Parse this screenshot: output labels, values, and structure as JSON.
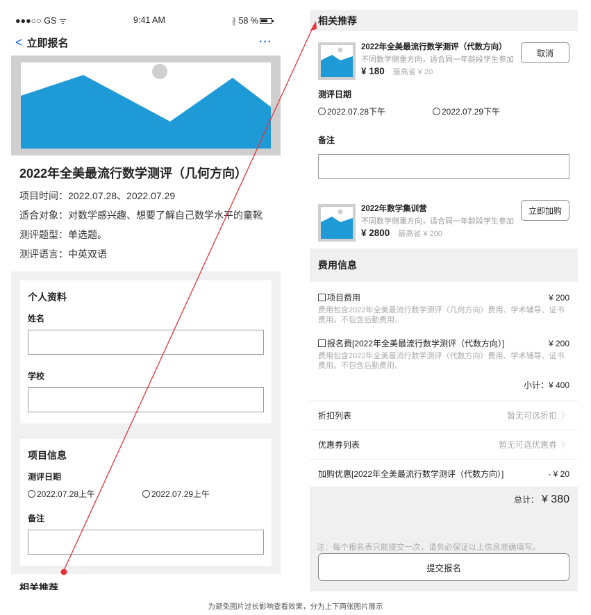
{
  "status_bar": {
    "carrier": "●●●○○ GS",
    "wifi_icon": "wifi-icon",
    "time": "9:41 AM",
    "battery": "58 %",
    "bluetooth_icon": "bluetooth-icon"
  },
  "nav": {
    "back_label": "立即报名",
    "more": "···"
  },
  "event": {
    "title": "2022年全美最流行数学测评（几何方向）",
    "time": "项目时间：2022.07.28、2022.07.29",
    "audience": "适合对象：对数学感兴趣、想要了解自己数学水平的童靴",
    "question_type": "测评题型：单选题。",
    "language": "测评语言：中英双语"
  },
  "personal": {
    "heading": "个人资料",
    "name_label": "姓名",
    "school_label": "学校"
  },
  "project": {
    "heading": "项目信息",
    "date_label": "测评日期",
    "date_options": [
      "2022.07.28上午",
      "2022.07.29上午"
    ],
    "remark_label": "备注"
  },
  "left_footer": {
    "related": "相关推荐"
  },
  "related": {
    "heading": "相关推荐",
    "item1": {
      "name": "2022年全美最流行数学测评（代数方向）",
      "desc": "不同数学侧重方向，适合同一年龄段学生参加",
      "price": "¥ 180",
      "save": "最高省 ¥ 20",
      "button": "取消"
    },
    "date_label": "测评日期",
    "date_options": [
      "2022.07.28下午",
      "2022.07.29下午"
    ],
    "remark_label": "备注",
    "item2": {
      "name": "2022年数学集训营",
      "desc": "不同数学侧重方向，适合同一年龄段学生参加",
      "price": "¥ 2800",
      "save": "最高省 ¥ 200",
      "button": "立即加购"
    }
  },
  "fees": {
    "heading": "费用信息",
    "items": [
      {
        "name": "项目费用",
        "amount": "¥ 200",
        "desc": "费用包含2022年全美最流行数学测评（几何方向）费用、学术辅导、证书费用。不包含后勤费用、"
      },
      {
        "name": "报名费[2022年全美最流行数学测评（代数方向）]",
        "amount": "¥ 200",
        "desc": "费用包含2022年全美最流行数学测评（代数方向）费用、学术辅导、证书费用。不包含后勤费用、"
      }
    ],
    "subtotal": "小计：¥ 400",
    "discount_label": "折扣列表",
    "discount_hint": "暂无可选折扣",
    "coupon_label": "优惠券列表",
    "coupon_hint": "暂无可选优惠券",
    "addon_label": "加购优惠[2022年全美最流行数学测评（代数方向）]",
    "addon_amount": "- ¥ 20",
    "total_label": "总计：",
    "total_value": "¥ 380",
    "note": "注：每个报名表只能提交一次，请务必保证以上信息准确填写。",
    "submit": "提交报名"
  },
  "caption": "为避免图片过长影响查看效果，分为上下两张图片展示",
  "colors": {
    "accent": "#1e6fd9",
    "image_blue": "#1e9ad6",
    "arrow": "#e8323c"
  }
}
